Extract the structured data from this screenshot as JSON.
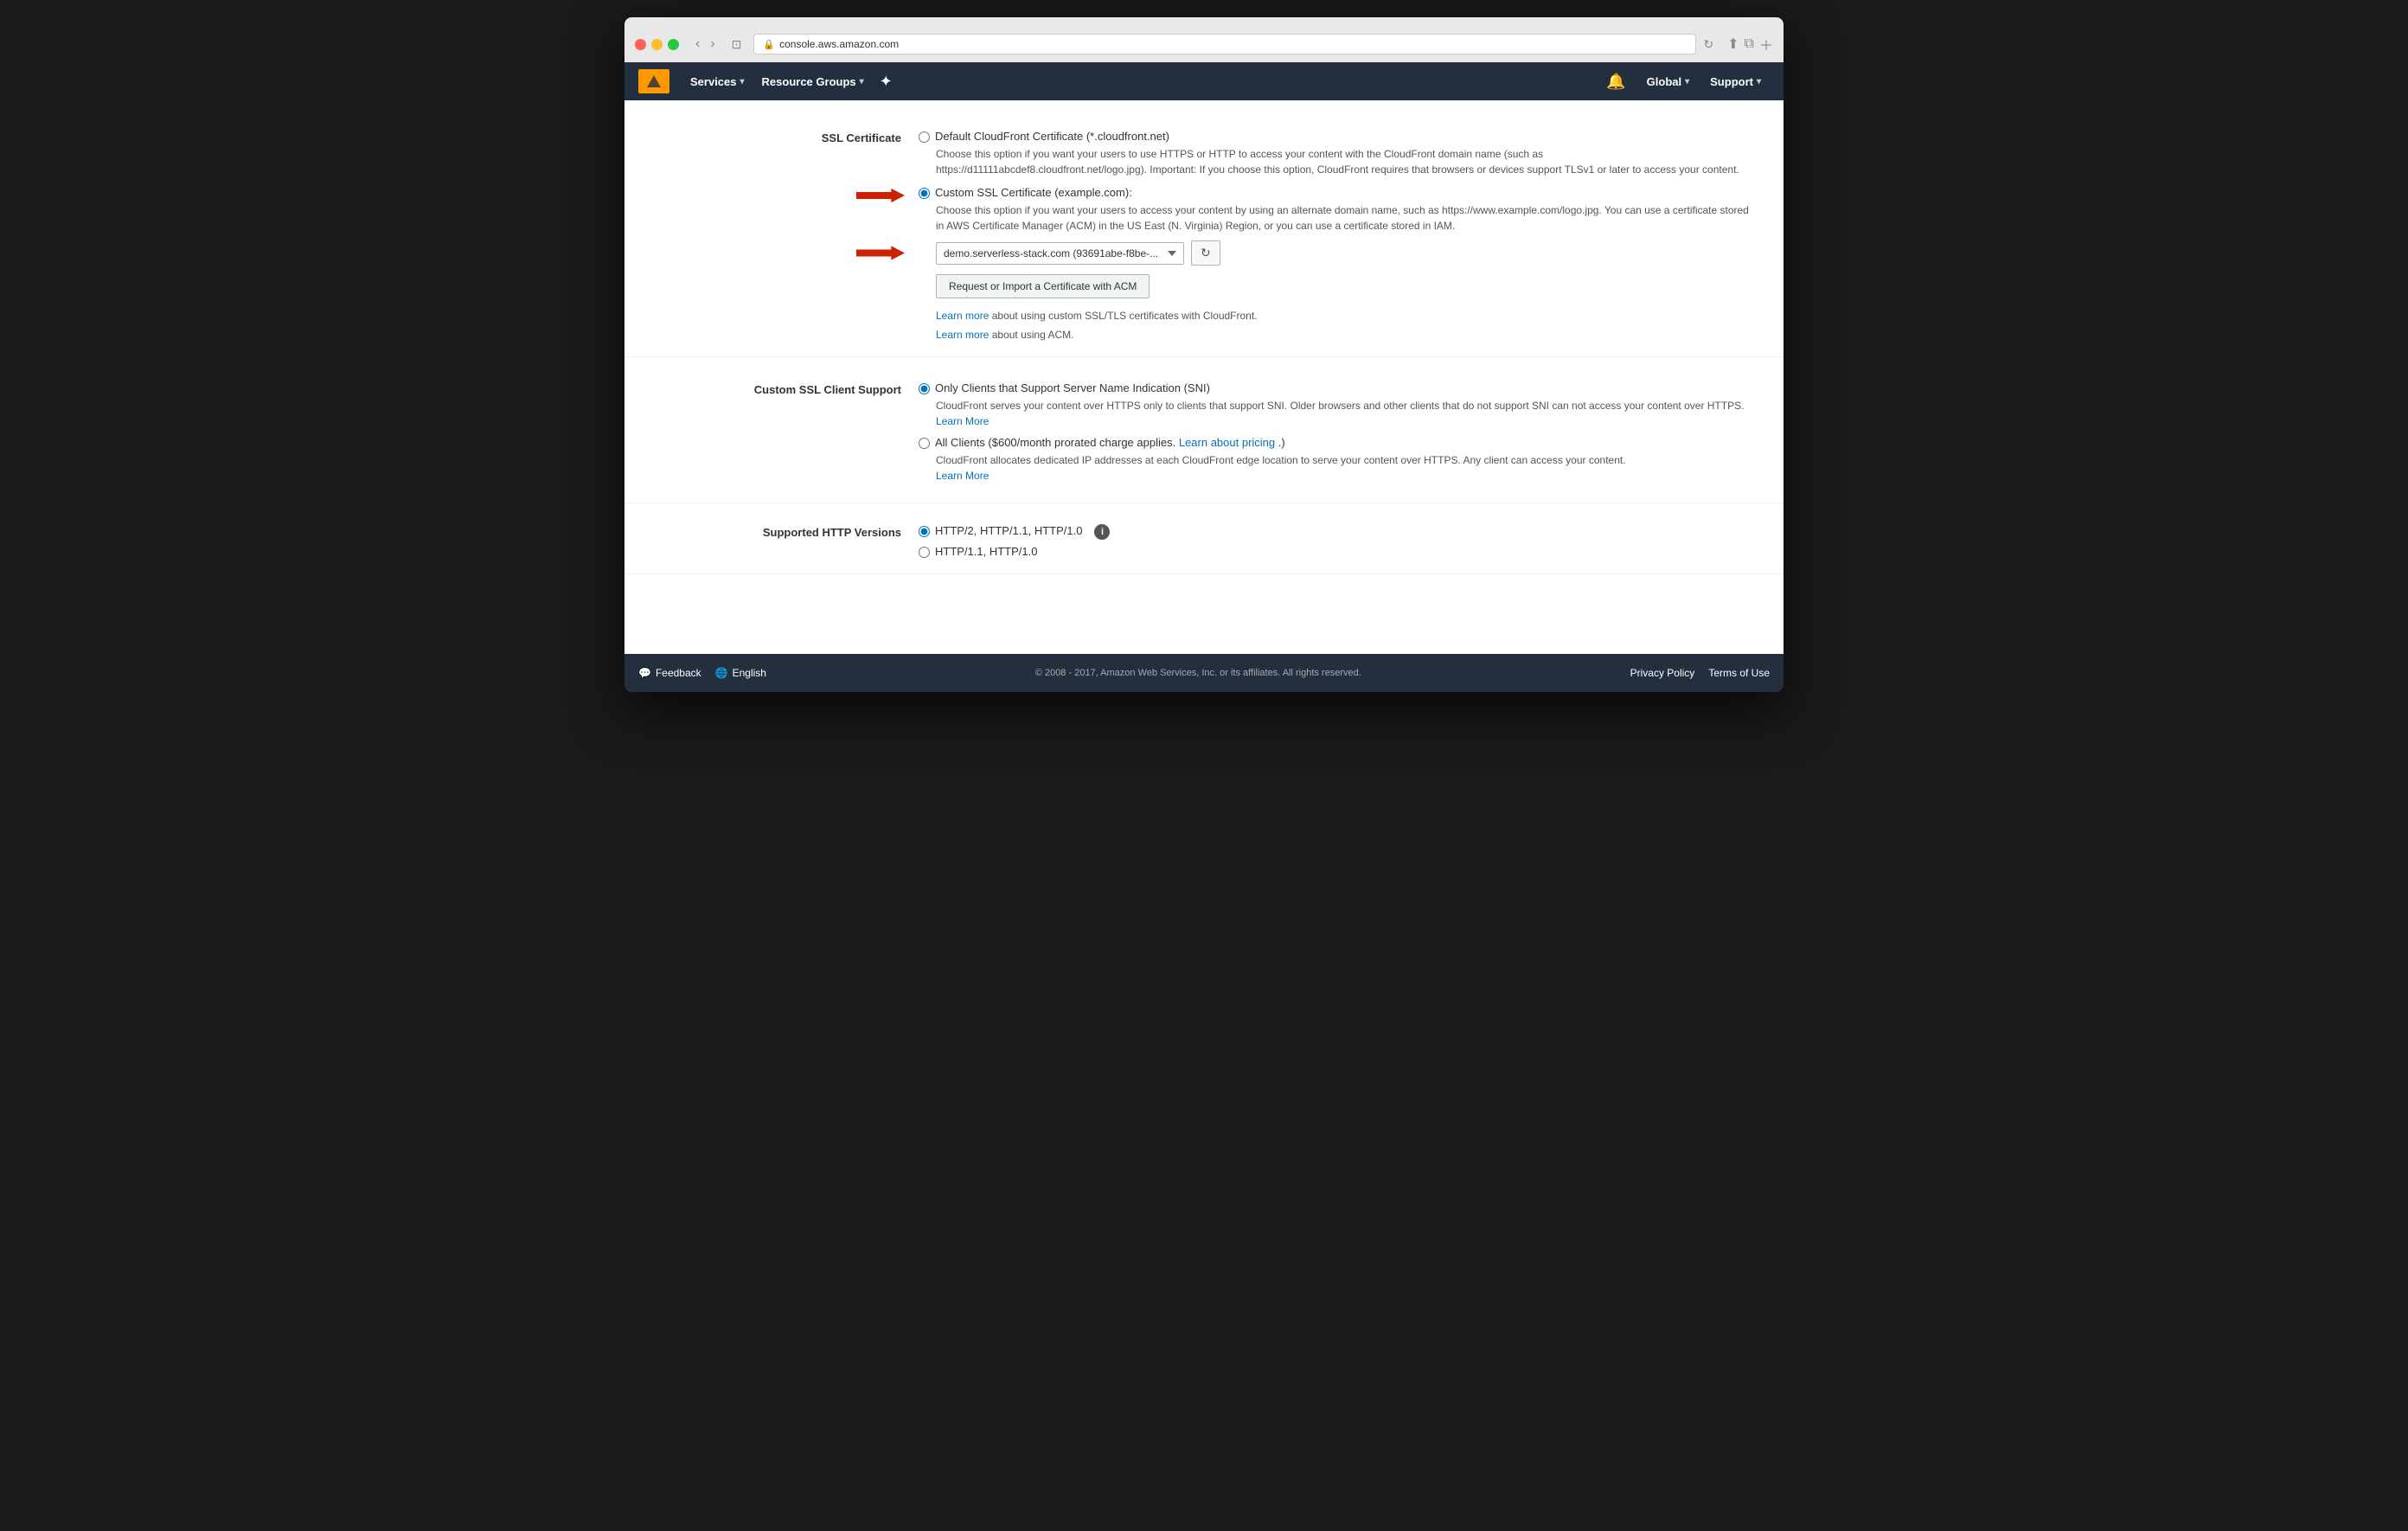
{
  "browser": {
    "url": "console.aws.amazon.com",
    "reload_label": "↻"
  },
  "nav": {
    "logo_alt": "AWS",
    "services_label": "Services",
    "resource_groups_label": "Resource Groups",
    "global_label": "Global",
    "support_label": "Support"
  },
  "ssl_certificate": {
    "section_label": "SSL Certificate",
    "option1_label": "Default CloudFront Certificate (*.cloudfront.net)",
    "option1_desc": "Choose this option if you want your users to use HTTPS or HTTP to access your content with the CloudFront domain name (such as https://d11111abcdef8.cloudfront.net/logo.jpg). Important: If you choose this option, CloudFront requires that browsers or devices support TLSv1 or later to access your content.",
    "option2_label": "Custom SSL Certificate (example.com):",
    "option2_desc": "Choose this option if you want your users to access your content by using an alternate domain name, such as https://www.example.com/logo.jpg. You can use a certificate stored in AWS Certificate Manager (ACM) in the US East (N. Virginia) Region, or you can use a certificate stored in IAM.",
    "cert_select_value": "demo.serverless-stack.com (93691abe-f8be-...",
    "cert_select_options": [
      "demo.serverless-stack.com (93691abe-f8be-..."
    ],
    "refresh_icon": "↻",
    "import_btn_label": "Request or Import a Certificate with ACM",
    "learn_more1_prefix": "",
    "learn_more1_link": "Learn more",
    "learn_more1_suffix": " about using custom SSL/TLS certificates with CloudFront.",
    "learn_more2_link": "Learn more",
    "learn_more2_suffix": " about using ACM."
  },
  "custom_ssl_client": {
    "section_label": "Custom SSL Client Support",
    "option1_label": "Only Clients that Support Server Name Indication (SNI)",
    "option1_desc": "CloudFront serves your content over HTTPS only to clients that support SNI. Older browsers and other clients that do not support SNI can not access your content over HTTPS.",
    "option1_learn_more": "Learn More",
    "option2_label": "All Clients ($600/month prorated charge applies.",
    "option2_link": "Learn about pricing",
    "option2_suffix": ".)",
    "option2_desc": "CloudFront allocates dedicated IP addresses at each CloudFront edge location to serve your content over HTTPS. Any client can access your content.",
    "option2_learn_more": "Learn More"
  },
  "http_versions": {
    "section_label": "Supported HTTP Versions",
    "option1_label": "HTTP/2, HTTP/1.1, HTTP/1.0",
    "option2_label": "HTTP/1.1, HTTP/1.0"
  },
  "footer": {
    "feedback_label": "Feedback",
    "english_label": "English",
    "copyright": "© 2008 - 2017, Amazon Web Services, Inc. or its affiliates. All rights reserved.",
    "privacy_policy_label": "Privacy Policy",
    "terms_of_use_label": "Terms of Use"
  }
}
